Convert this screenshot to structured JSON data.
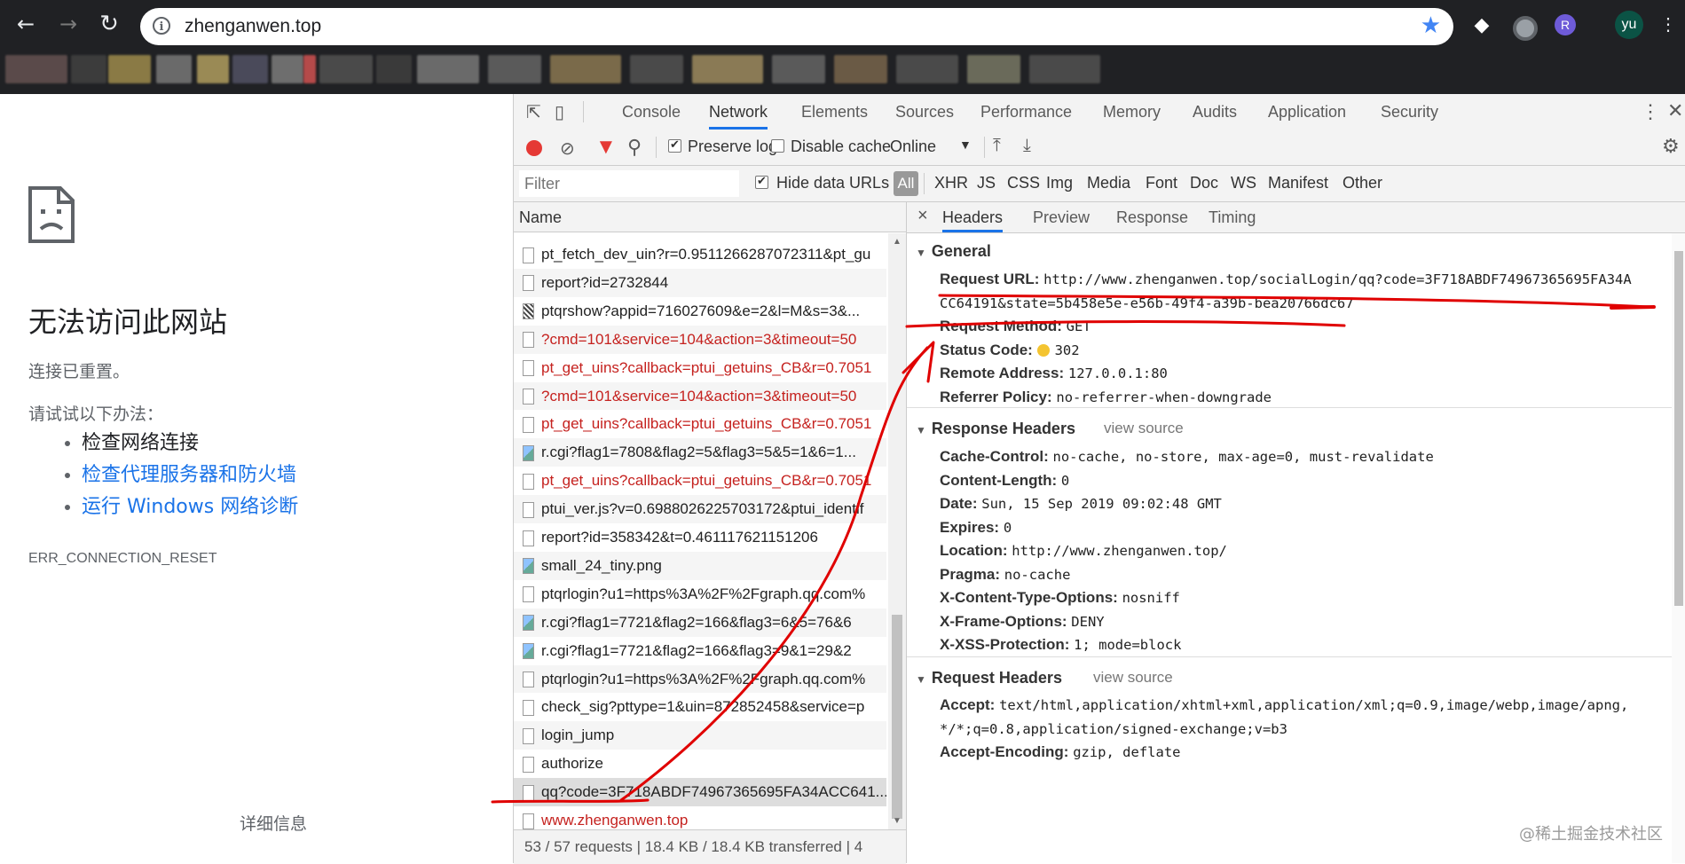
{
  "browser": {
    "url": "zhenganwen.top",
    "profile_initials": "yu",
    "ext_r_label": "R"
  },
  "error_page": {
    "title": "无法访问此网站",
    "subtitle": "连接已重置。",
    "try_label": "请试试以下办法：",
    "suggestions": [
      "检查网络连接",
      "检查代理服务器和防火墙",
      "运行 Windows 网络诊断"
    ],
    "error_code": "ERR_CONNECTION_RESET",
    "details_button": "详细信息"
  },
  "devtools": {
    "tabs": [
      "Console",
      "Network",
      "Elements",
      "Sources",
      "Performance",
      "Memory",
      "Audits",
      "Application",
      "Security"
    ],
    "active_tab": "Network",
    "toolbar": {
      "preserve_log": "Preserve log",
      "disable_cache": "Disable cache",
      "throttling": "Online"
    },
    "filter": {
      "placeholder": "Filter",
      "hide_data_urls": "Hide data URLs",
      "types": [
        "All",
        "XHR",
        "JS",
        "CSS",
        "Img",
        "Media",
        "Font",
        "Doc",
        "WS",
        "Manifest",
        "Other"
      ]
    },
    "list": {
      "header": "Name",
      "rows": [
        {
          "name": "pt_fetch_dev_uin?r=0.9511266287072311&pt_gu",
          "icon": "doc-icon",
          "error": false
        },
        {
          "name": "report?id=2732844",
          "icon": "doc-icon",
          "error": false
        },
        {
          "name": "ptqrshow?appid=716027609&e=2&l=M&s=3&...",
          "icon": "qr-image-icon",
          "error": false
        },
        {
          "name": "?cmd=101&service=104&action=3&timeout=50",
          "icon": "doc-icon",
          "error": true
        },
        {
          "name": "pt_get_uins?callback=ptui_getuins_CB&r=0.7051",
          "icon": "doc-icon",
          "error": true
        },
        {
          "name": "?cmd=101&service=104&action=3&timeout=50",
          "icon": "doc-icon",
          "error": true
        },
        {
          "name": "pt_get_uins?callback=ptui_getuins_CB&r=0.7051",
          "icon": "doc-icon",
          "error": true
        },
        {
          "name": "r.cgi?flag1=7808&flag2=5&flag3=5&5=1&6=1...",
          "icon": "image-icon",
          "error": false
        },
        {
          "name": "pt_get_uins?callback=ptui_getuins_CB&r=0.7051",
          "icon": "doc-icon",
          "error": true
        },
        {
          "name": "ptui_ver.js?v=0.6988026225703172&ptui_identif",
          "icon": "doc-icon",
          "error": false
        },
        {
          "name": "report?id=358342&t=0.461117621151206",
          "icon": "doc-icon",
          "error": false
        },
        {
          "name": "small_24_tiny.png",
          "icon": "image-icon",
          "error": false
        },
        {
          "name": "ptqrlogin?u1=https%3A%2F%2Fgraph.qq.com%",
          "icon": "doc-icon",
          "error": false
        },
        {
          "name": "r.cgi?flag1=7721&flag2=166&flag3=6&5=76&6",
          "icon": "image-icon",
          "error": false
        },
        {
          "name": "r.cgi?flag1=7721&flag2=166&flag3=9&1=29&2",
          "icon": "image-icon",
          "error": false
        },
        {
          "name": "ptqrlogin?u1=https%3A%2F%2Fgraph.qq.com%",
          "icon": "doc-icon",
          "error": false
        },
        {
          "name": "check_sig?pttype=1&uin=872852458&service=p",
          "icon": "doc-icon",
          "error": false
        },
        {
          "name": "login_jump",
          "icon": "doc-icon",
          "error": false
        },
        {
          "name": "authorize",
          "icon": "doc-icon",
          "error": false
        },
        {
          "name": "qq?code=3F718ABDF74967365695FA34ACC641...",
          "icon": "doc-icon",
          "error": false,
          "selected": true
        },
        {
          "name": "www.zhenganwen.top",
          "icon": "doc-icon",
          "error": true
        }
      ],
      "status": "53 / 57 requests   |   18.4 KB / 18.4 KB transferred   |   4"
    },
    "detail": {
      "tabs": [
        "Headers",
        "Preview",
        "Response",
        "Timing"
      ],
      "active_tab": "Headers",
      "general_title": "General",
      "general": [
        {
          "k": "Request URL:",
          "v": "http://www.zhenganwen.top/socialLogin/qq?code=3F718ABDF74967365695FA34A"
        },
        {
          "k": "",
          "v": "CC64191&state=5b458e5e-e56b-49f4-a39b-bea20766dc67"
        },
        {
          "k": "Request Method:",
          "v": "GET"
        },
        {
          "k": "Status Code:",
          "v": "302"
        },
        {
          "k": "Remote Address:",
          "v": "127.0.0.1:80"
        },
        {
          "k": "Referrer Policy:",
          "v": "no-referrer-when-downgrade"
        }
      ],
      "response_title": "Response Headers",
      "response_view_source": "view source",
      "response": [
        {
          "k": "Cache-Control:",
          "v": "no-cache, no-store, max-age=0, must-revalidate"
        },
        {
          "k": "Content-Length:",
          "v": "0"
        },
        {
          "k": "Date:",
          "v": "Sun, 15 Sep 2019 09:02:48 GMT"
        },
        {
          "k": "Expires:",
          "v": "0"
        },
        {
          "k": "Location:",
          "v": "http://www.zhenganwen.top/"
        },
        {
          "k": "Pragma:",
          "v": "no-cache"
        },
        {
          "k": "X-Content-Type-Options:",
          "v": "nosniff"
        },
        {
          "k": "X-Frame-Options:",
          "v": "DENY"
        },
        {
          "k": "X-XSS-Protection:",
          "v": "1; mode=block"
        }
      ],
      "request_title": "Request Headers",
      "request_view_source": "view source",
      "request": [
        {
          "k": "Accept:",
          "v": "text/html,application/xhtml+xml,application/xml;q=0.9,image/webp,image/apng,"
        },
        {
          "k": "",
          "v": "*/*;q=0.8,application/signed-exchange;v=b3"
        },
        {
          "k": "Accept-Encoding:",
          "v": "gzip, deflate"
        }
      ]
    }
  },
  "watermark": "@稀土掘金技术社区",
  "colors": {
    "error_text": "#c5221f",
    "accent": "#1a73e8",
    "annotation": "#e00000",
    "status_dot": "#f4c430"
  }
}
